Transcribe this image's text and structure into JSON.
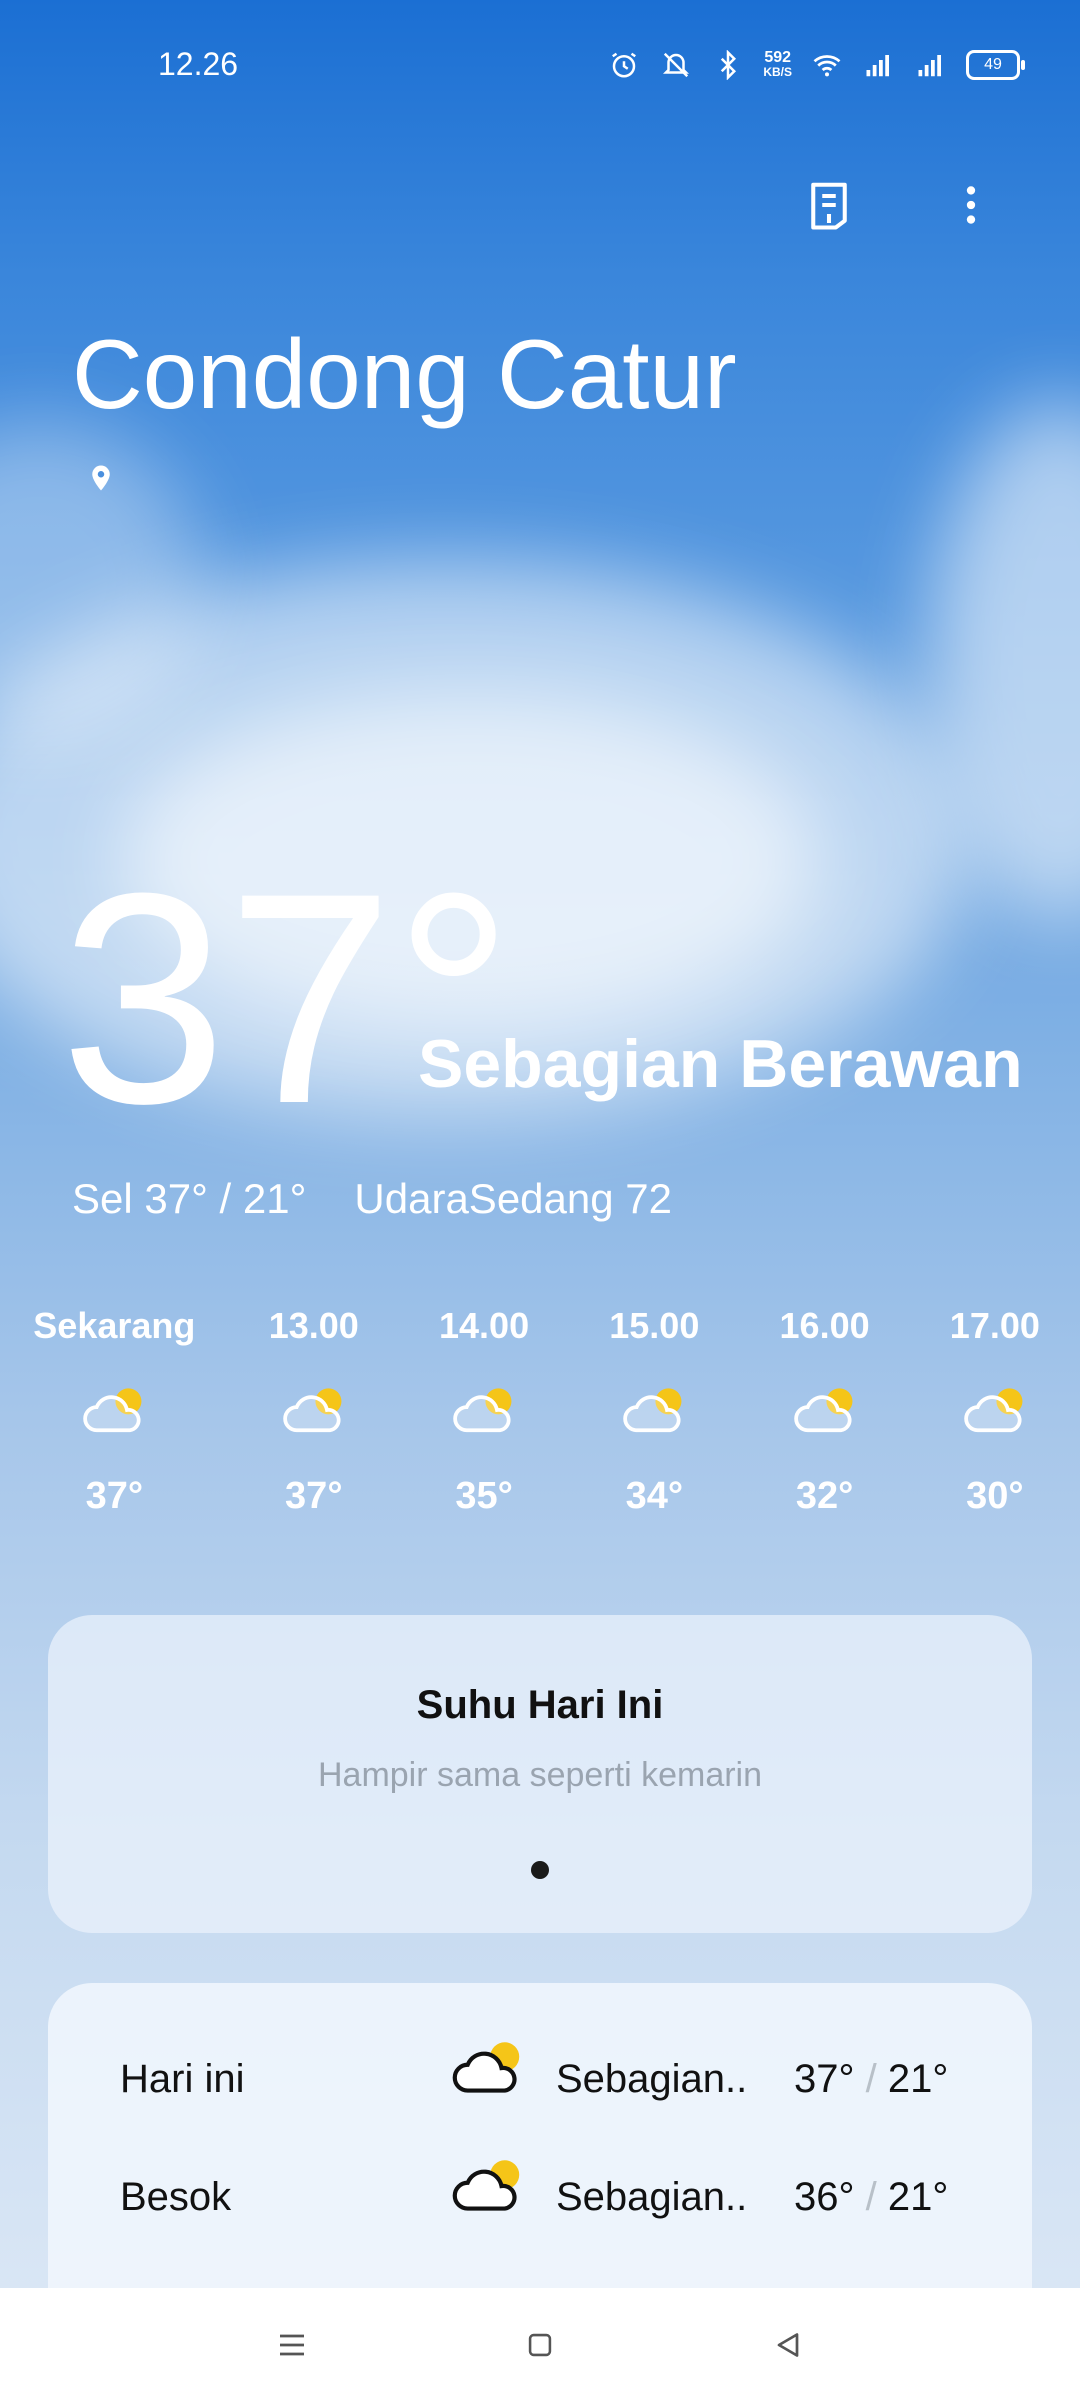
{
  "status_bar": {
    "time": "12.26",
    "net_speed_value": "592",
    "net_speed_unit": "KB/S",
    "battery": "49"
  },
  "location": {
    "city": "Condong Catur"
  },
  "current": {
    "temperature": "37°",
    "condition": "Sebagian Berawan",
    "day_range": "Sel 37° / 21°",
    "air_quality": "UdaraSedang 72"
  },
  "hourly": [
    {
      "time": "Sekarang",
      "temp": "37°",
      "icon": "partly-cloudy-icon"
    },
    {
      "time": "13.00",
      "temp": "37°",
      "icon": "partly-cloudy-icon"
    },
    {
      "time": "14.00",
      "temp": "35°",
      "icon": "partly-cloudy-icon"
    },
    {
      "time": "15.00",
      "temp": "34°",
      "icon": "partly-cloudy-icon"
    },
    {
      "time": "16.00",
      "temp": "32°",
      "icon": "partly-cloudy-icon"
    },
    {
      "time": "17.00",
      "temp": "30°",
      "icon": "partly-cloudy-icon"
    }
  ],
  "today_card": {
    "title": "Suhu Hari Ini",
    "subtitle": "Hampir sama seperti kemarin"
  },
  "forecast": [
    {
      "day": "Hari ini",
      "condition": "Sebagian..",
      "high": "37°",
      "low": "21°",
      "icon": "partly-cloudy-icon"
    },
    {
      "day": "Besok",
      "condition": "Sebagian..",
      "high": "36°",
      "low": "21°",
      "icon": "partly-cloudy-icon"
    }
  ],
  "forecast_sep": "/",
  "colors": {
    "sun": "#f5c518",
    "sky_top": "#1b6fd3",
    "sky_bottom": "#d9e6f5"
  }
}
